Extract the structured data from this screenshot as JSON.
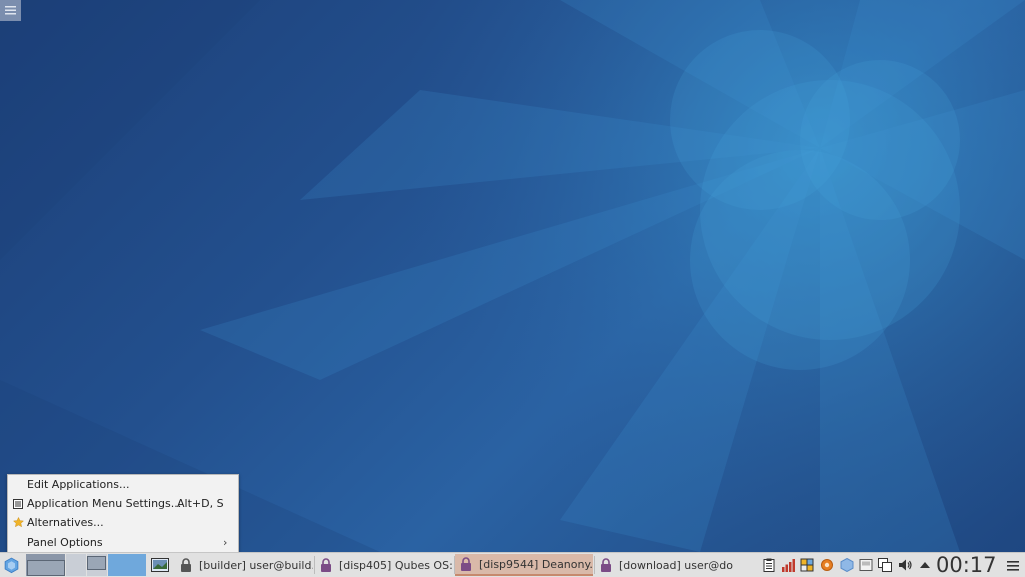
{
  "desktop": {
    "top_menu_icon": "hamburger-menu-icon"
  },
  "context_menu": {
    "items": [
      {
        "label": "Edit Applications...",
        "icon": "",
        "accel": "",
        "submenu": false
      },
      {
        "label": "Application Menu Settings...",
        "icon": "settings-list-icon",
        "accel": "Alt+D, S",
        "submenu": false
      },
      {
        "label": "Alternatives...",
        "icon": "star-icon",
        "accel": "",
        "submenu": false
      },
      {
        "label": "Panel Options",
        "icon": "",
        "accel": "",
        "submenu": true
      }
    ]
  },
  "taskbar": {
    "tasks": [
      {
        "label": "[builder] user@build...",
        "lock_color": "#555555",
        "active": false
      },
      {
        "label": "[disp405] Qubes OS:...",
        "lock_color": "#7b4b86",
        "active": false
      },
      {
        "label": "[disp9544] Deanony...",
        "lock_color": "#7b4b86",
        "active": true
      },
      {
        "label": "[download] user@do...",
        "lock_color": "#7b4b86",
        "active": false
      }
    ],
    "clock": "00:17",
    "colors": {
      "accent": "#c6896d",
      "workspace_active": "#6fa8dc"
    }
  }
}
